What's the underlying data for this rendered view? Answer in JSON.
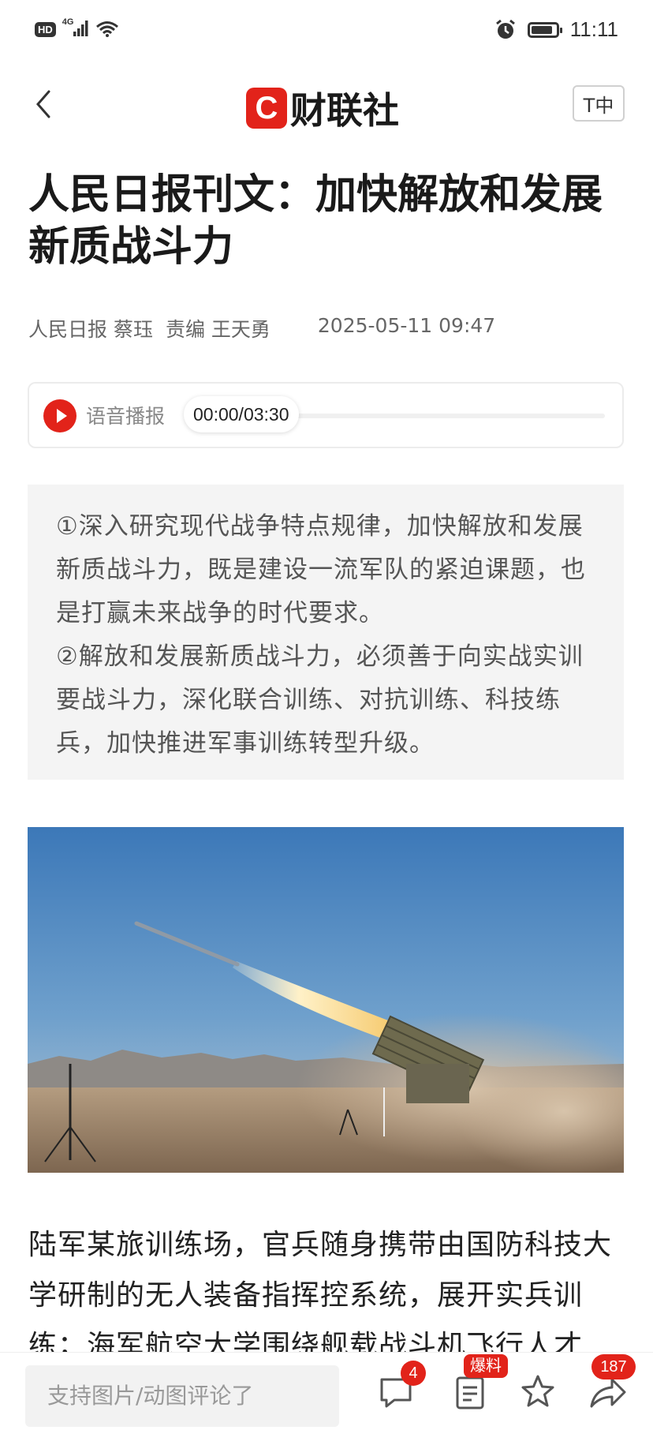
{
  "status_bar": {
    "hd": "HD",
    "network": "4G",
    "time": "11:11",
    "battery_level": 0.9
  },
  "header": {
    "logo_mark": "C",
    "logo_text": "财联社",
    "font_size_button": "T中"
  },
  "article": {
    "title": "人民日报刊文：加快解放和发展新质战斗力",
    "source": "人民日报 蔡珏",
    "editor": "责编 王天勇",
    "datetime": "2025-05-11 09:47",
    "audio": {
      "label": "语音播报",
      "time": "00:00/03:30",
      "progress": 0
    },
    "summary": [
      "①深入研究现代战争特点规律，加快解放和发展新质战斗力，既是建设一流军队的紧迫课题，也是打赢未来战争的时代要求。",
      "②解放和发展新质战斗力，必须善于向实战实训要战斗力，深化联合训练、对抗训练、科技练兵，加快推进军事训练转型升级。"
    ],
    "body": "陆军某旅训练场，官兵随身携带由国防科技大学研制的无人装备指挥控系统，展开实兵训练；海军航空大学围绕舰载战斗机飞行人才"
  },
  "bottom_bar": {
    "comment_placeholder": "支持图片/动图评论了",
    "comment_count": "4",
    "report_badge": "爆料",
    "share_count": "187"
  },
  "colors": {
    "accent": "#e2231a",
    "summary_bg": "#f4f4f4"
  }
}
